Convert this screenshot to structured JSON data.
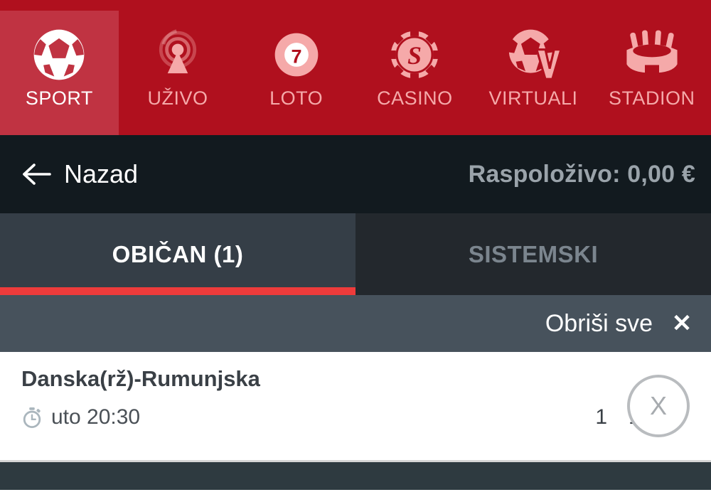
{
  "colors": {
    "brand_red": "#b0101e",
    "brand_red_active": "#c03342",
    "accent_red": "#ee3b3b",
    "nav_label": "#f5a9a9",
    "dark_bar": "#121a1f",
    "tab_active_bg": "#353e47",
    "tab_inactive_bg": "#23282d",
    "clearbar_bg": "#47525c",
    "footer_bg": "#2e3a40"
  },
  "topnav": {
    "items": [
      {
        "label": "SPORT",
        "icon": "soccer-ball-icon",
        "active": true
      },
      {
        "label": "UŽIVO",
        "icon": "live-broadcast-icon",
        "active": false
      },
      {
        "label": "LOTO",
        "icon": "lotto-ball-7-icon",
        "active": false
      },
      {
        "label": "CASINO",
        "icon": "casino-chip-icon",
        "active": false
      },
      {
        "label": "VIRTUALI",
        "icon": "virtual-sports-icon",
        "active": false
      },
      {
        "label": "STADION",
        "icon": "stadium-icon",
        "active": false
      }
    ]
  },
  "backbar": {
    "back_label": "Nazad",
    "back_icon": "arrow-left-icon",
    "balance_text": "Raspoloživo: 0,00 €"
  },
  "tabs": [
    {
      "label": "OBIČAN (1)",
      "active": true
    },
    {
      "label": "SISTEMSKI",
      "active": false
    }
  ],
  "clearbar": {
    "clear_all_label": "Obriši sve",
    "close_icon_glyph": "✕"
  },
  "betslip": {
    "items": [
      {
        "match": "Danska(rž)-Rumunjska",
        "time_icon": "stopwatch-icon",
        "time": "uto 20:30",
        "pick": "1",
        "odds": "1,25",
        "remove_glyph": "X"
      }
    ]
  }
}
